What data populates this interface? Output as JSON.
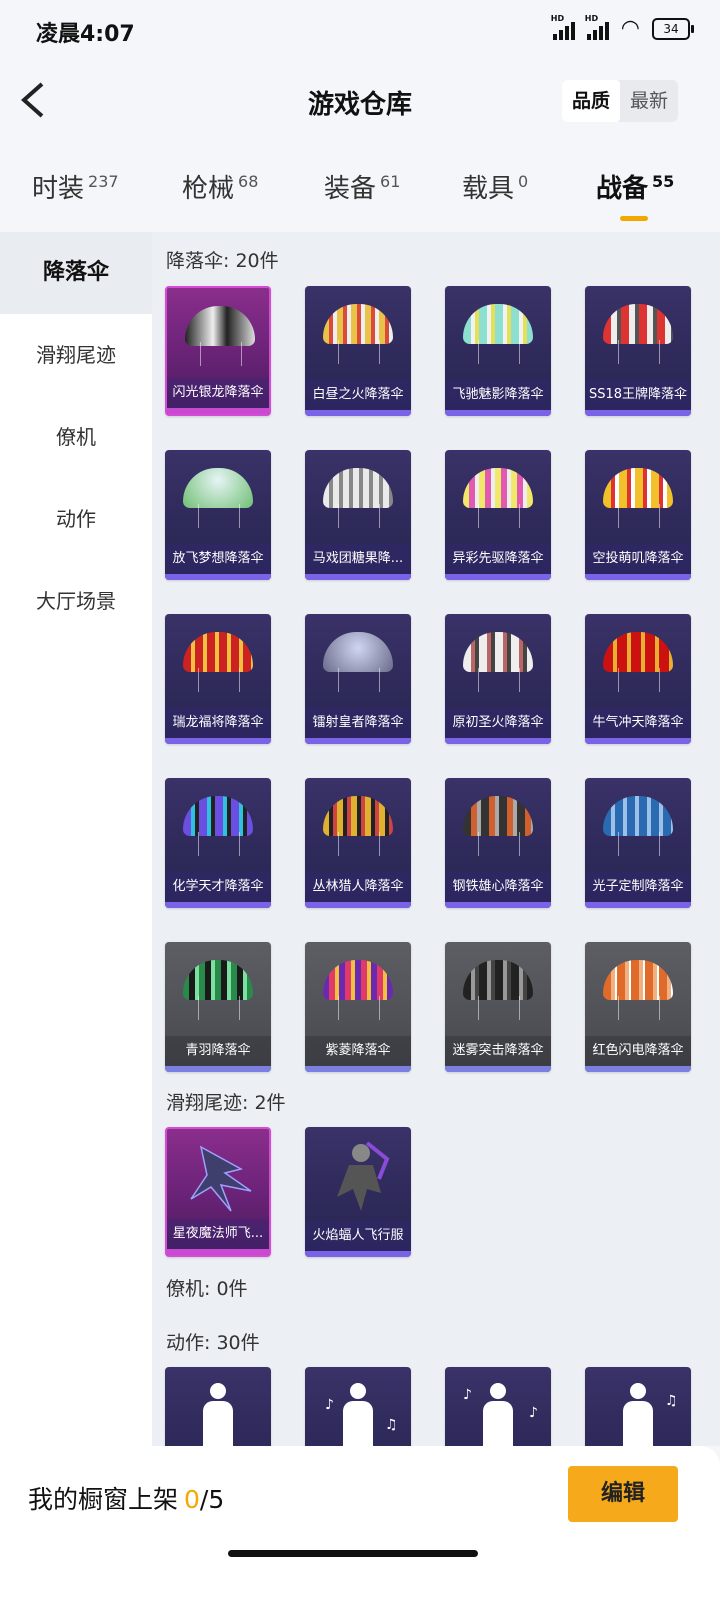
{
  "status_bar": {
    "time": "凌晨4:07",
    "battery": "34",
    "network_label": "HD"
  },
  "header": {
    "title": "游戏仓库",
    "toggle": [
      "品质",
      "最新"
    ],
    "toggle_active": "品质"
  },
  "tabs": [
    {
      "label": "时装",
      "count": "237"
    },
    {
      "label": "枪械",
      "count": "68"
    },
    {
      "label": "装备",
      "count": "61"
    },
    {
      "label": "载具",
      "count": "0"
    },
    {
      "label": "战备",
      "count": "55"
    }
  ],
  "active_tab": "战备",
  "sidebar": [
    "降落伞",
    "滑翔尾迹",
    "僚机",
    "动作",
    "大厅场景"
  ],
  "sections": {
    "parachute": {
      "title": "降落伞: 20件",
      "items": [
        "闪光银龙降落伞",
        "白昼之火降落伞",
        "飞驰魅影降落伞",
        "SS18王牌降落伞",
        "放飞梦想降落伞",
        "马戏团糖果降...",
        "异彩先驱降落伞",
        "空投萌叽降落伞",
        "瑞龙福将降落伞",
        "镭射皇者降落伞",
        "原初圣火降落伞",
        "牛气冲天降落伞",
        "化学天才降落伞",
        "丛林猎人降落伞",
        "钢铁雄心降落伞",
        "光子定制降落伞",
        "青羽降落伞",
        "紫菱降落伞",
        "迷雾突击降落伞",
        "红色闪电降落伞"
      ]
    },
    "glide_trail": {
      "title": "滑翔尾迹: 2件",
      "items": [
        "星夜魔法师飞...",
        "火焰蝠人飞行服"
      ]
    },
    "wingman": {
      "title": "僚机: 0件"
    },
    "emote": {
      "title": "动作: 30件"
    }
  },
  "footer": {
    "label": "我的橱窗上架",
    "current": "0",
    "total": "/5",
    "edit": "编辑"
  },
  "colors": {
    "accent": "#f2a800",
    "card_purple": "#2e2a5a",
    "card_pink": "#6b2378",
    "card_grey": "#505157"
  }
}
